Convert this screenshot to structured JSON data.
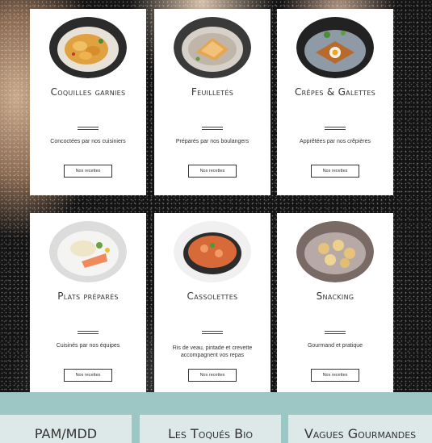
{
  "cards": [
    {
      "title": "Coquilles garnies",
      "desc": "Concoctées par nos cuisiniers",
      "button": "Nos recettes",
      "image": "pasta-shells-dish"
    },
    {
      "title": "Feuilletés",
      "desc": "Préparés par nos boulangers",
      "button": "Nos recettes",
      "image": "puff-pastry-dish"
    },
    {
      "title": "Crêpes & Galettes",
      "desc": "Apprêtées par nos crêpières",
      "button": "Nos recettes",
      "image": "galette-egg-dish"
    },
    {
      "title": "Plats préparés",
      "desc": "Cuisinés par nos équipes",
      "button": "Nos recettes",
      "image": "salmon-rice-dish"
    },
    {
      "title": "Cassolettes",
      "desc": "Ris de veau, pintade et crevette accompagnent vos repas",
      "button": "Nos recettes",
      "image": "shrimp-cassolette-dish"
    },
    {
      "title": "Snacking",
      "desc": "Gourmand et pratique",
      "button": "Nos recettes",
      "image": "mini-tartlets-dish"
    }
  ],
  "brands": [
    "PAM/MDD",
    "Les Toqués Bio",
    "Vagues Gourmandes"
  ],
  "colors": {
    "band": "#9cc7c4",
    "brand_tile": "#dde9e8",
    "card": "#ffffff"
  }
}
